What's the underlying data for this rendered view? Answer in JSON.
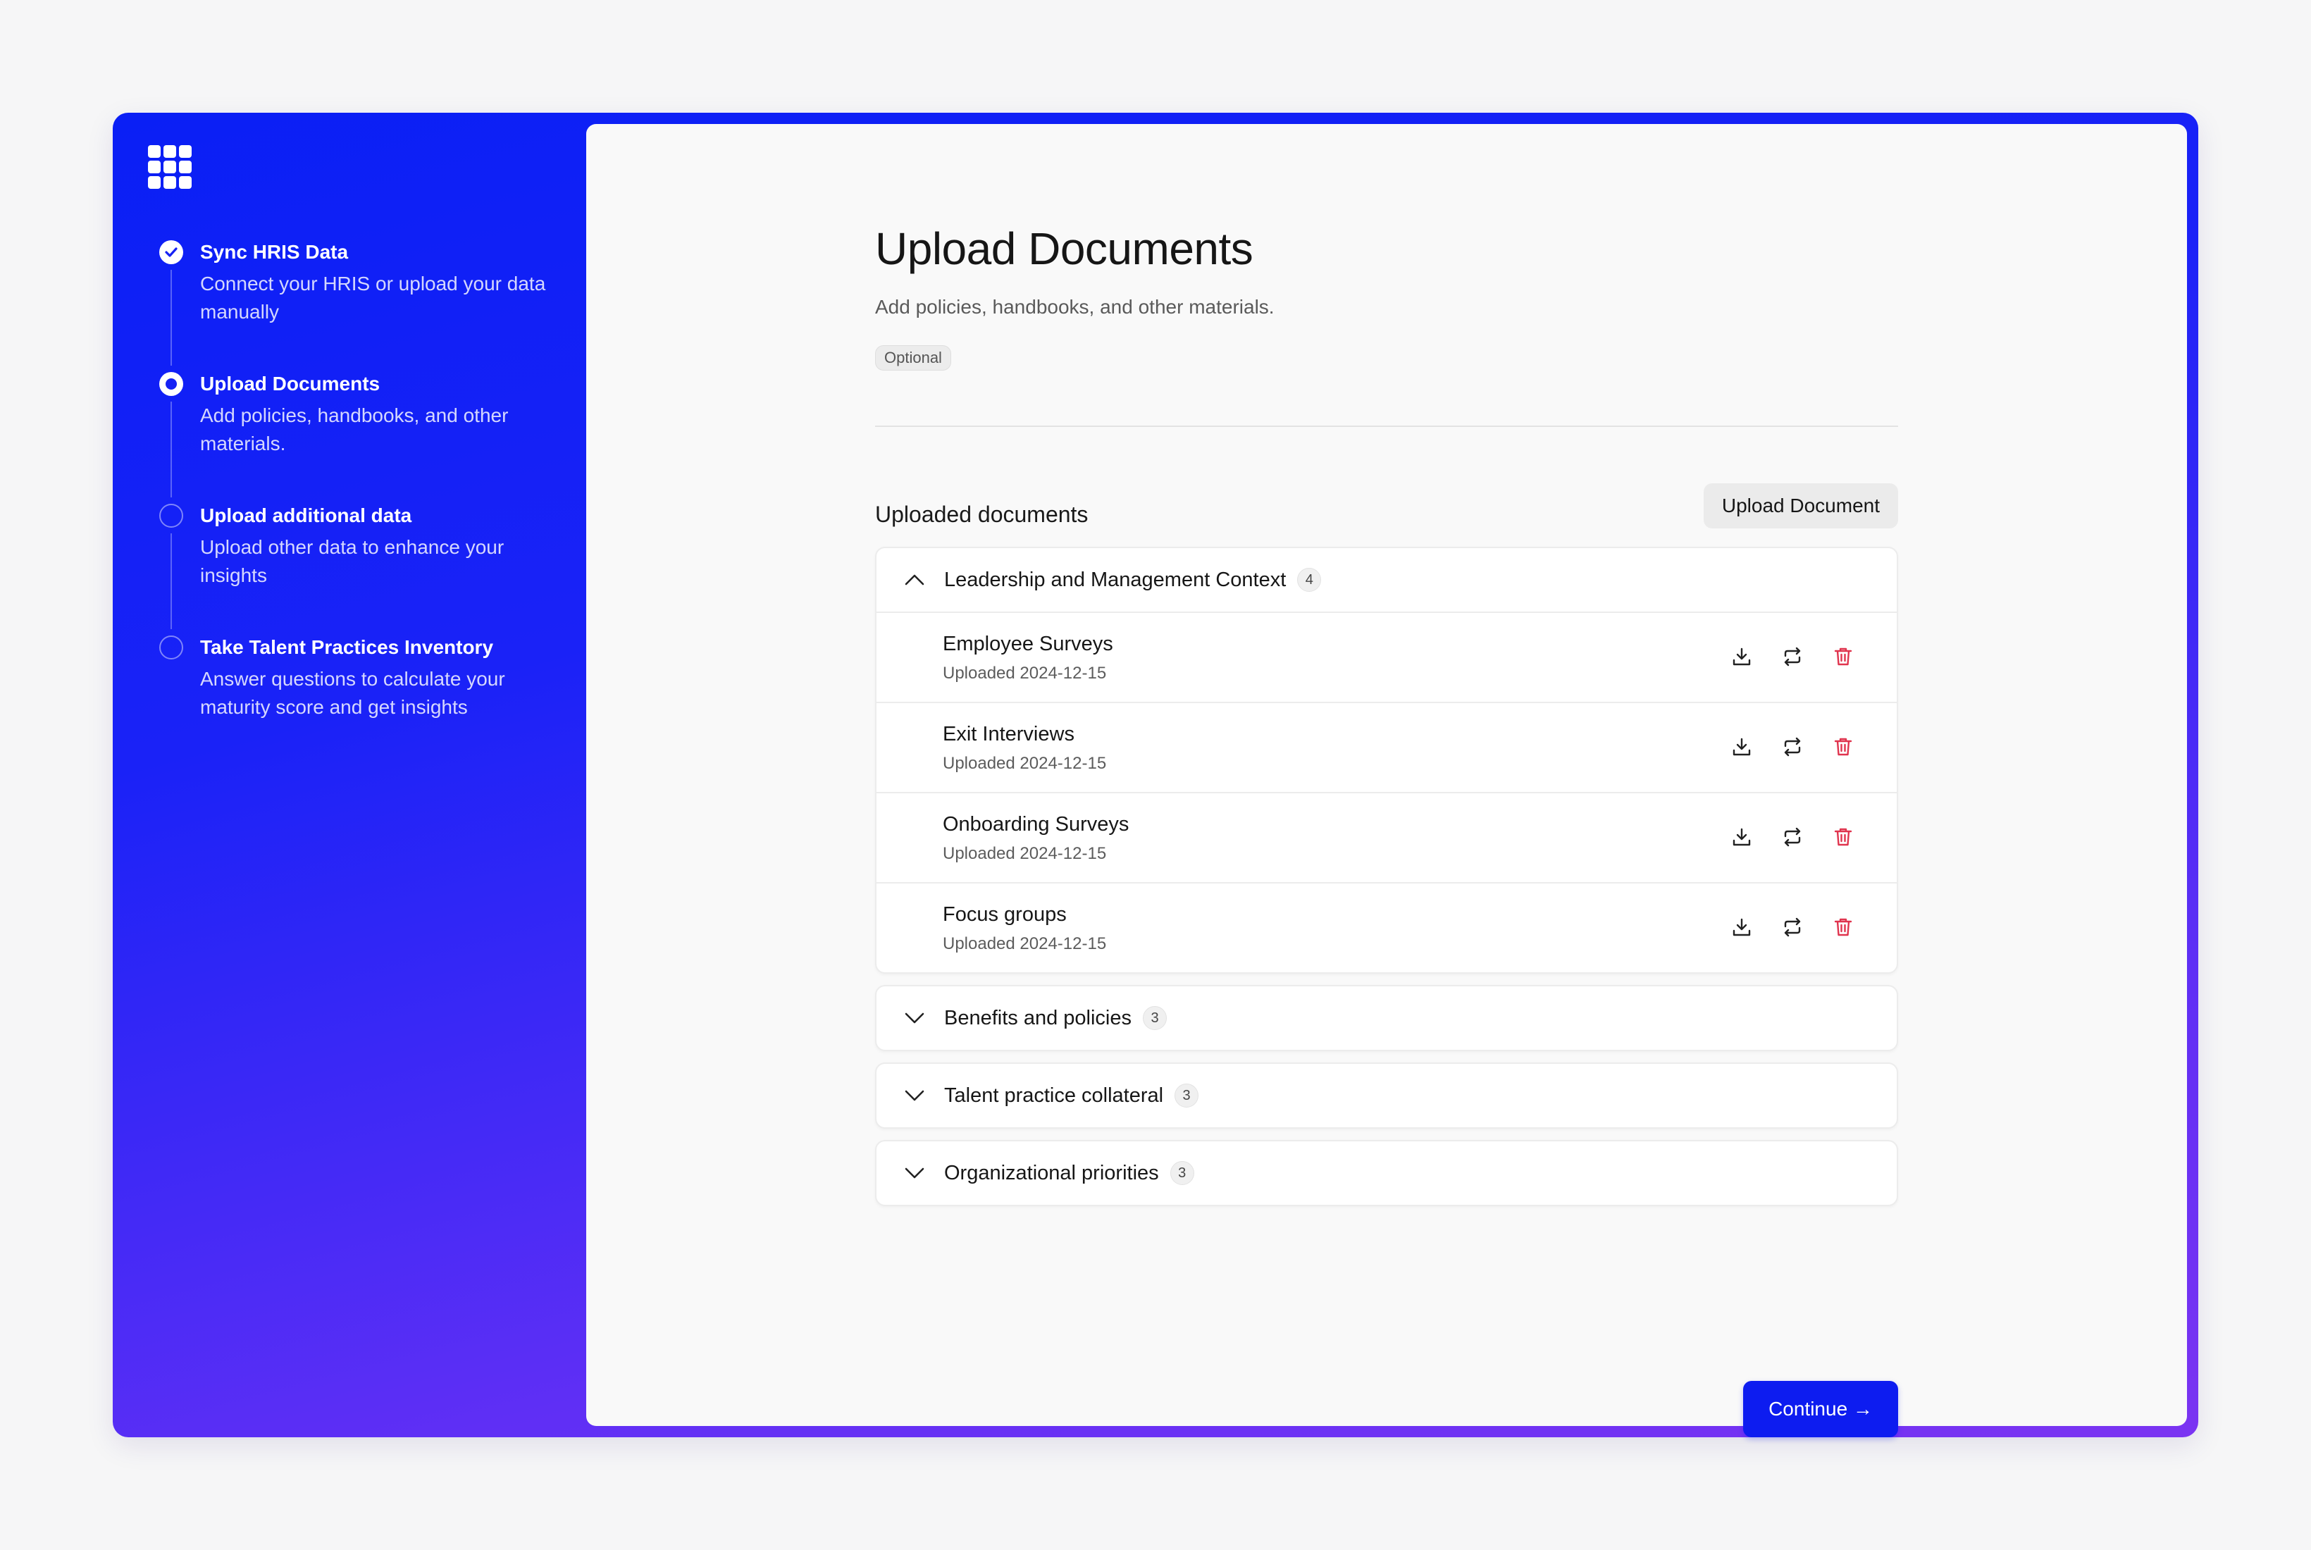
{
  "sidebar": {
    "steps": [
      {
        "title": "Sync HRIS Data",
        "desc": "Connect your HRIS or upload your data manually",
        "state": "done"
      },
      {
        "title": "Upload Documents",
        "desc": "Add policies, handbooks, and other materials.",
        "state": "current"
      },
      {
        "title": "Upload additional data",
        "desc": "Upload other data to enhance your insights",
        "state": "pending"
      },
      {
        "title": "Take Talent Practices Inventory",
        "desc": "Answer questions to calculate your maturity score and get insights",
        "state": "pending"
      }
    ]
  },
  "main": {
    "title": "Upload Documents",
    "subtitle": "Add policies, handbooks, and other materials.",
    "badge": "Optional",
    "section_title": "Uploaded documents",
    "upload_button": "Upload Document",
    "groups": [
      {
        "label": "Leadership and Management Context",
        "count": "4",
        "expanded": true,
        "docs": [
          {
            "name": "Employee Surveys",
            "date": "Uploaded 2024-12-15"
          },
          {
            "name": "Exit Interviews",
            "date": "Uploaded 2024-12-15"
          },
          {
            "name": "Onboarding Surveys",
            "date": "Uploaded 2024-12-15"
          },
          {
            "name": "Focus groups",
            "date": "Uploaded 2024-12-15"
          }
        ]
      },
      {
        "label": "Benefits and policies",
        "count": "3",
        "expanded": false
      },
      {
        "label": "Talent practice collateral",
        "count": "3",
        "expanded": false
      },
      {
        "label": "Organizational priorities",
        "count": "3",
        "expanded": false
      }
    ],
    "continue_button": "Continue →"
  },
  "colors": {
    "accent": "#0d1cf0",
    "danger": "#e0344e",
    "gradient_top": "#0a1ff5",
    "gradient_bottom": "#7b34f2"
  },
  "icons": [
    "grid-logo-icon",
    "check-icon",
    "chevron-up-icon",
    "chevron-down-icon",
    "download-icon",
    "replace-icon",
    "trash-icon"
  ]
}
